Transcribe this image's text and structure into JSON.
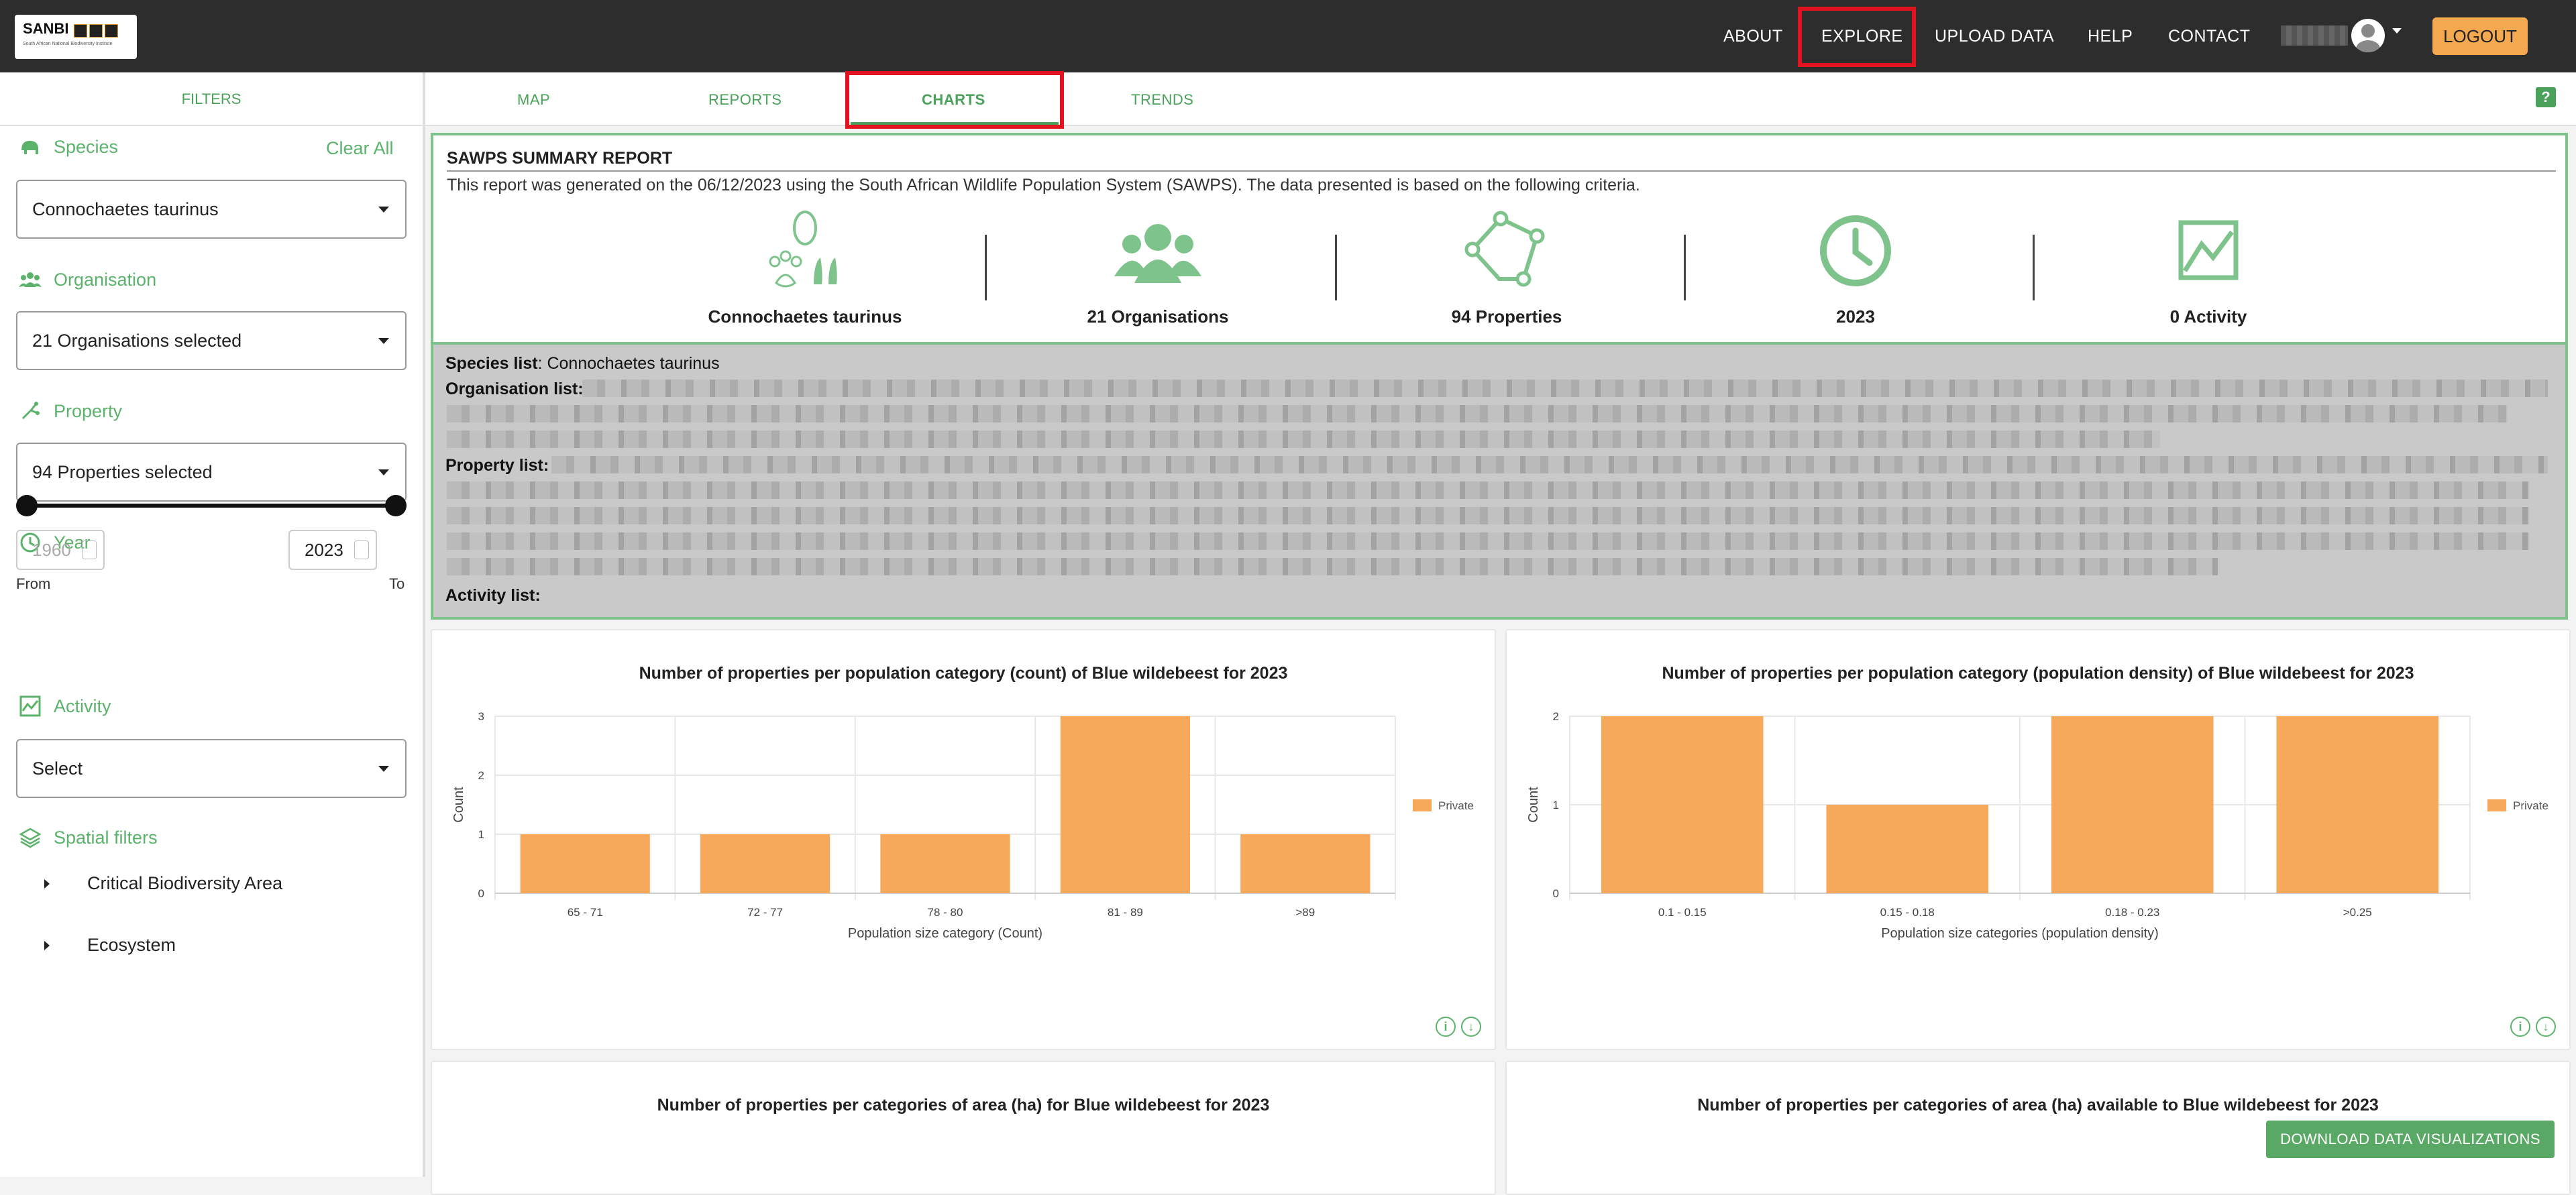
{
  "logo": {
    "title": "SANBI",
    "subtitle": "South African National Biodiversity Institute"
  },
  "nav": {
    "about": "ABOUT",
    "explore": "EXPLORE",
    "upload": "UPLOAD DATA",
    "help": "HELP",
    "contact": "CONTACT",
    "logout": "LOGOUT"
  },
  "sidebar": {
    "header": "FILTERS",
    "species_label": "Species",
    "clear_all": "Clear All",
    "species_value": "Connochaetes taurinus",
    "organisation_label": "Organisation",
    "organisation_value": "21 Organisations selected",
    "property_label": "Property",
    "property_value": "94 Properties selected",
    "year_label": "Year",
    "year_from": "1960",
    "year_to": "2023",
    "from_label": "From",
    "to_label": "To",
    "activity_label": "Activity",
    "activity_value": "Select",
    "spatial_label": "Spatial filters",
    "spatial_items": [
      "Critical Biodiversity Area",
      "Ecosystem"
    ]
  },
  "tabs": [
    "MAP",
    "REPORTS",
    "CHARTS",
    "TRENDS"
  ],
  "active_tab": "CHARTS",
  "help_icon": "?",
  "report": {
    "title": "SAWPS SUMMARY REPORT",
    "subtitle": "This report was generated on the 06/12/2023 using the South African Wildlife Population System (SAWPS). The data presented is based on the following criteria.",
    "stats": [
      {
        "icon": "paw-icon",
        "label": "Connochaetes taurinus"
      },
      {
        "icon": "organisations-icon",
        "label": "21 Organisations"
      },
      {
        "icon": "properties-icon",
        "label": "94 Properties"
      },
      {
        "icon": "clock-icon",
        "label": "2023"
      },
      {
        "icon": "activity-icon",
        "label": "0 Activity"
      }
    ],
    "species_list_label": "Species list",
    "species_list_value": ": Connochaetes taurinus",
    "organisation_list_label": "Organisation list:",
    "property_list_label": "Property list:",
    "activity_list_label": "Activity list:"
  },
  "accent": "#4aa25a",
  "bar_color": "#f6a85b",
  "chart_data": [
    {
      "type": "bar",
      "title": "Number of properties per population category (count) of Blue wildebeest for 2023",
      "categories": [
        "65 - 71",
        "72 - 77",
        "78 - 80",
        "81 - 89",
        ">89"
      ],
      "series": [
        {
          "name": "Private",
          "values": [
            1,
            1,
            1,
            3,
            1
          ]
        }
      ],
      "xlabel": "Population size category (Count)",
      "ylabel": "Count",
      "ylim": [
        0,
        3
      ],
      "yticks": [
        0,
        1,
        2,
        3
      ],
      "legend": "right"
    },
    {
      "type": "bar",
      "title": "Number of properties per population category (population density) of Blue wildebeest for 2023",
      "categories": [
        "0.1 - 0.15",
        "0.15 - 0.18",
        "0.18 - 0.23",
        ">0.25"
      ],
      "series": [
        {
          "name": "Private",
          "values": [
            2,
            1,
            2,
            2
          ]
        }
      ],
      "xlabel": "Population size categories (population density)",
      "ylabel": "Count",
      "ylim": [
        0,
        2
      ],
      "yticks": [
        0,
        1,
        2
      ],
      "legend": "right"
    }
  ],
  "lower_cards": [
    "Number of properties per categories of area (ha) for Blue wildebeest for 2023",
    "Number of properties per categories of area (ha) available to Blue wildebeest for 2023"
  ],
  "download_button": "DOWNLOAD DATA VISUALIZATIONS"
}
